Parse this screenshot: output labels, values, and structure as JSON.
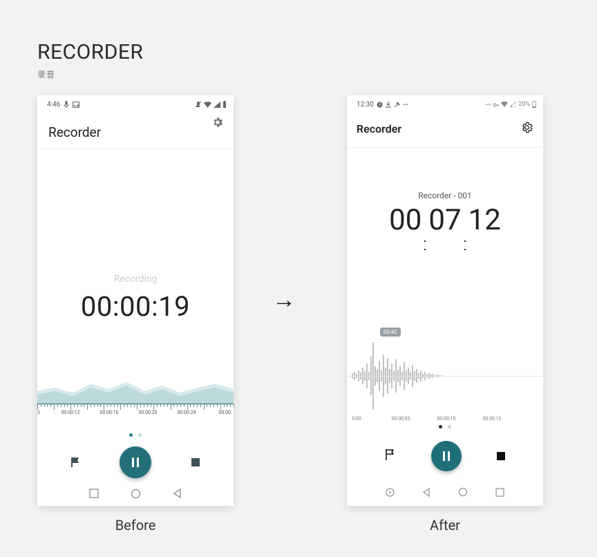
{
  "heading": {
    "title": "RECORDER",
    "subtitle": "录音"
  },
  "arrow": "→",
  "captions": {
    "before": "Before",
    "after": "After"
  },
  "colors": {
    "teal": "#23707a",
    "wave_light": "#d8eaec",
    "wave_dark": "#bcd9db"
  },
  "before": {
    "status": {
      "time": "4:46",
      "left_icons": [
        "mic-icon",
        "image-icon"
      ],
      "right_icons": [
        "mute-icon",
        "wifi-icon",
        "signal-icon",
        "battery-icon"
      ]
    },
    "app_title": "Recorder",
    "recording_label": "Recording",
    "timer": "00:00:19",
    "ruler": [
      "3",
      "00:00:12",
      "00:00:16",
      "00:00:20",
      "00:00:24",
      "00:00:"
    ],
    "pager": {
      "count": 2,
      "active": 0
    },
    "controls": {
      "flag": "flag",
      "center": "pause",
      "stop": "stop"
    },
    "nav": [
      "square",
      "circle",
      "triangle"
    ]
  },
  "after": {
    "status": {
      "time": "12:30",
      "left_icons": [
        "clock-alert-icon",
        "download-icon",
        "tools-icon",
        "more-icon"
      ],
      "right_label": "20%",
      "right_icons": [
        "more-dots-icon",
        "key-icon",
        "wifi-icon",
        "signal-icon",
        "battery-icon"
      ]
    },
    "app_title": "Recorder",
    "recording_name": "Recorder - 001",
    "timer_parts": [
      "00",
      "07",
      "12"
    ],
    "marker_badge": "00:42",
    "ruler": [
      "0:00",
      "00:00:05",
      "00:00:10",
      "00:00:15"
    ],
    "pager": {
      "count": 2,
      "active": 0
    },
    "controls": {
      "flag": "flag-outline",
      "center": "pause",
      "stop": "stop"
    },
    "nav": [
      "dot-circle",
      "triangle",
      "circle",
      "square"
    ]
  },
  "chart_data": [
    {
      "type": "area",
      "note": "Before phone — soft dual-layer amplitude wave",
      "x_unit": "seconds",
      "xlim": [
        8,
        28
      ],
      "series": [
        {
          "name": "back_layer",
          "color": "#d8eaec",
          "amplitude_norm": [
            0.35,
            0.45,
            0.3,
            0.55,
            0.4,
            0.6,
            0.35,
            0.5,
            0.3,
            0.45,
            0.55,
            0.4
          ]
        },
        {
          "name": "front_layer",
          "color": "#bcd9db",
          "amplitude_norm": [
            0.25,
            0.35,
            0.2,
            0.45,
            0.3,
            0.5,
            0.25,
            0.4,
            0.2,
            0.35,
            0.45,
            0.3
          ]
        }
      ],
      "xticks": [
        "00:00:12",
        "00:00:16",
        "00:00:20",
        "00:00:24"
      ]
    },
    {
      "type": "bar",
      "note": "After phone — vertical amplitude spikes centered on midline",
      "x_unit": "seconds",
      "xlim": [
        0,
        16
      ],
      "markers": [
        {
          "label": "00:42",
          "x_index": 10
        }
      ],
      "series": [
        {
          "name": "amplitude",
          "color": "#7b7f83",
          "values": [
            4,
            6,
            3,
            8,
            5,
            12,
            7,
            18,
            6,
            28,
            48,
            14,
            9,
            22,
            8,
            30,
            12,
            26,
            10,
            18,
            7,
            24,
            9,
            14,
            6,
            20,
            8,
            12,
            5,
            16,
            7,
            10,
            4,
            8,
            3,
            6,
            2,
            4,
            2,
            3,
            1,
            2,
            1,
            1,
            0,
            0,
            0,
            0,
            0,
            0,
            0,
            0
          ]
        }
      ],
      "xticks": [
        "0:00",
        "00:00:05",
        "00:00:10",
        "00:00:15"
      ]
    }
  ]
}
